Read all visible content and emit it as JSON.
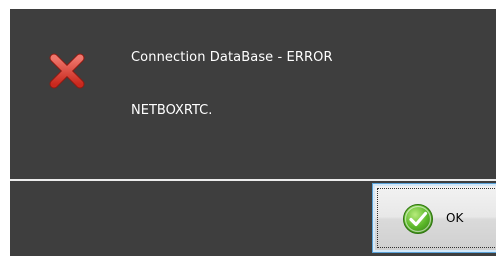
{
  "dialog": {
    "icon": "error-x-icon",
    "message_title": "Connection DataBase - ERROR",
    "message_detail": "NETBOXRTC.",
    "ok_button": {
      "label": "OK",
      "icon": "green-check-icon"
    }
  },
  "colors": {
    "dialog_background": "#3e3e3e",
    "text": "#ffffff",
    "error_icon": "#d9352a",
    "ok_icon": "#5cb82a",
    "button_focus_border": "#5aa2d8"
  }
}
